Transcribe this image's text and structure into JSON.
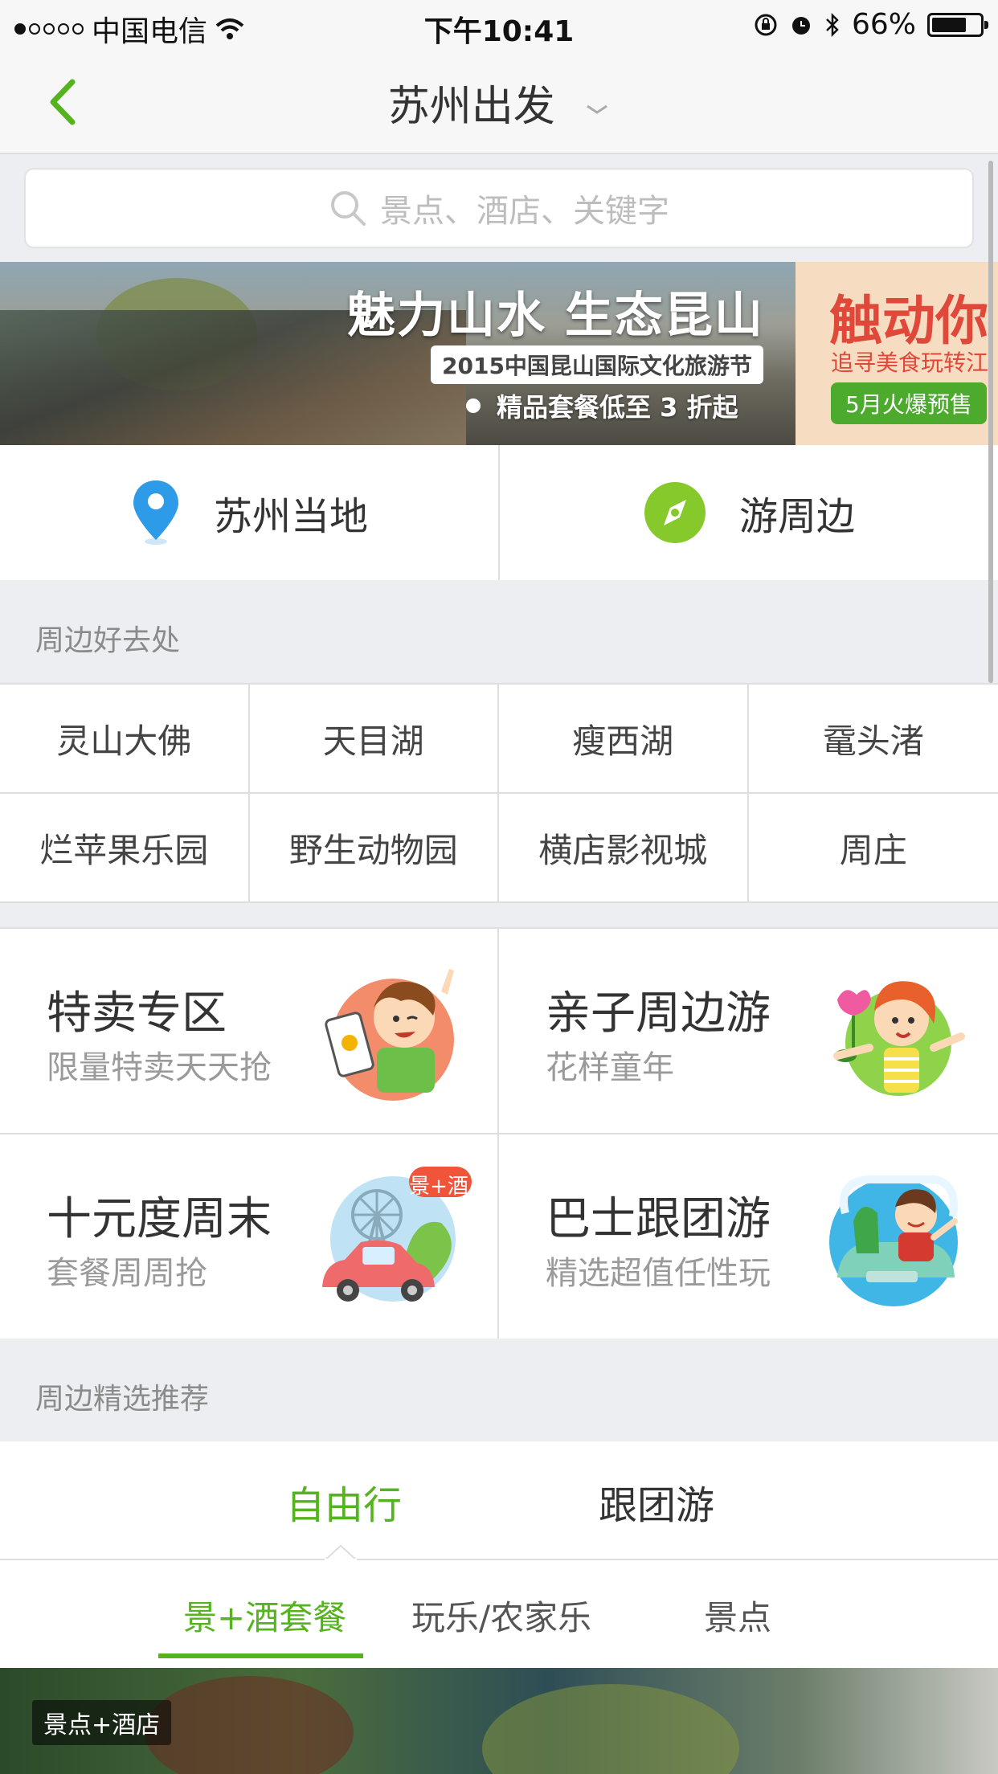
{
  "statusbar": {
    "carrier": "中国电信",
    "time": "下午10:41",
    "battery": "66%"
  },
  "nav": {
    "title": "苏州出发"
  },
  "search": {
    "placeholder": "景点、酒店、关键字"
  },
  "banner": {
    "main_title": "魅力山水 生态昆山",
    "main_sub": "2015中国昆山国际文化旅游节",
    "main_promo": "精品套餐低至 3 折起",
    "side_title": "触动你",
    "side_sub": "追寻美食玩转江",
    "side_tag": "5月火爆预售"
  },
  "quick": [
    {
      "label": "苏州当地",
      "icon": "location-pin-icon"
    },
    {
      "label": "游周边",
      "icon": "compass-icon"
    }
  ],
  "section1": {
    "title": "周边好去处"
  },
  "destinations": [
    "灵山大佛",
    "天目湖",
    "瘦西湖",
    "鼋头渚",
    "烂苹果乐园",
    "野生动物园",
    "横店影视城",
    "周庄"
  ],
  "features": [
    {
      "title": "特卖专区",
      "subtitle": "限量特卖天天抢"
    },
    {
      "title": "亲子周边游",
      "subtitle": "花样童年"
    },
    {
      "title": "十元度周末",
      "subtitle": "套餐周周抢",
      "badge": "景+酒"
    },
    {
      "title": "巴士跟团游",
      "subtitle": "精选超值任性玩"
    }
  ],
  "section2": {
    "title": "周边精选推荐"
  },
  "tabs": [
    "自由行",
    "跟团游"
  ],
  "subtabs": [
    "景+酒套餐",
    "玩乐/农家乐",
    "景点"
  ],
  "photo": {
    "tag": "景点+酒店"
  },
  "colors": {
    "accent": "#56b320",
    "pin": "#2e9be8",
    "bg": "#eceef1"
  }
}
